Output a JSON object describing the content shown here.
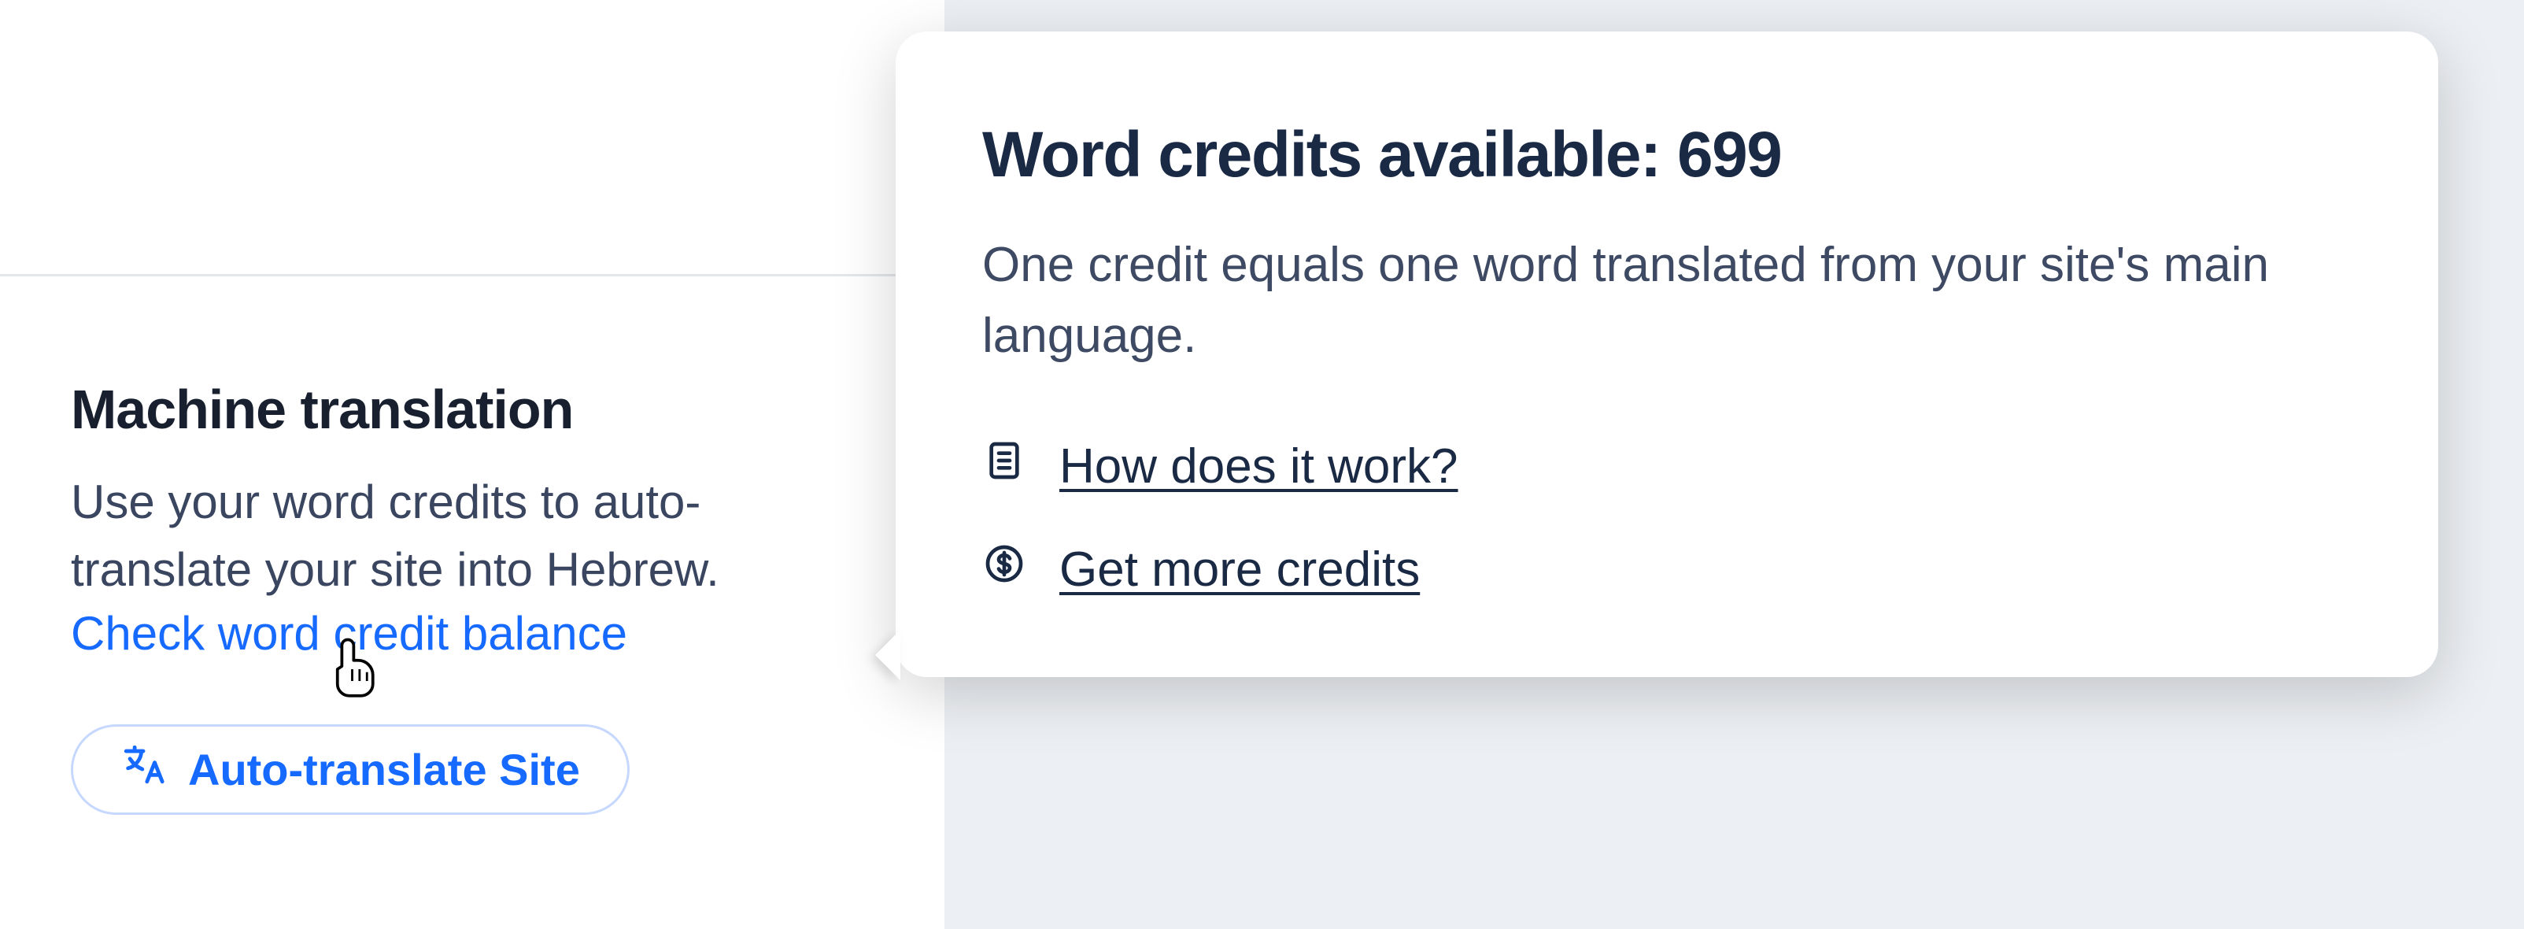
{
  "section": {
    "title": "Machine translation",
    "description": "Use your word credits to auto-translate your site into Hebrew.",
    "check_link": "Check word credit balance",
    "auto_translate_button": "Auto-translate Site"
  },
  "tooltip": {
    "title_prefix": "Word credits available: ",
    "credits": "699",
    "description": "One credit equals one word translated from your site's main language.",
    "links": {
      "how": "How does it work?",
      "get_more": "Get more credits"
    }
  }
}
